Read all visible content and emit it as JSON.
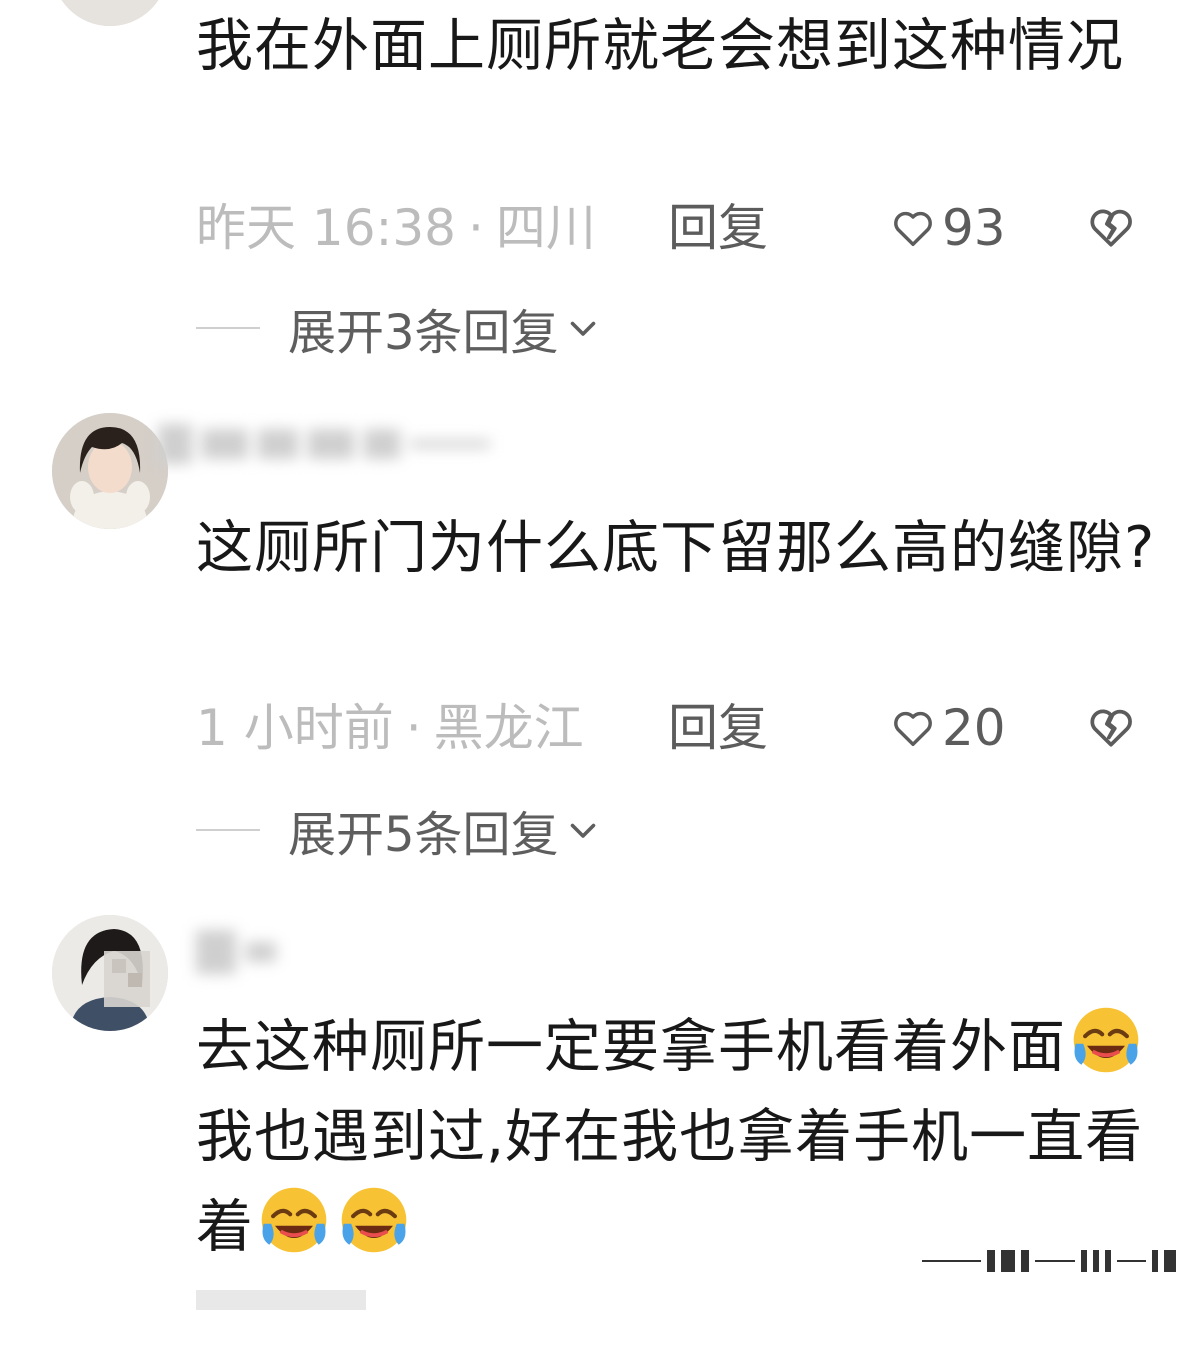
{
  "comments": [
    {
      "text": "我在外面上厕所就老会想到这种情况",
      "time": "昨天 16:38",
      "sep": "·",
      "location": "四川",
      "reply_label": "回复",
      "likes": "93",
      "expand_label": "展开3条回复"
    },
    {
      "text": "这厕所门为什么底下留那么高的缝隙?",
      "time": "1 小时前",
      "sep": "·",
      "location": "黑龙江",
      "reply_label": "回复",
      "likes": "20",
      "expand_label": "展开5条回复"
    },
    {
      "text_part1": "去这种厕所一定要拿手机看着外面",
      "text_part2": "我也遇到过,好在我也拿着手机一直看着",
      "emoji": "rolling-on-floor-laughing-emoji"
    }
  ],
  "icons": {
    "like": "heart-outline-icon",
    "dislike": "broken-heart-icon",
    "expand": "chevron-down-icon"
  },
  "colors": {
    "meta_gray": "#bcbcbc",
    "action_gray": "#5c5c5c",
    "text": "#181818"
  }
}
